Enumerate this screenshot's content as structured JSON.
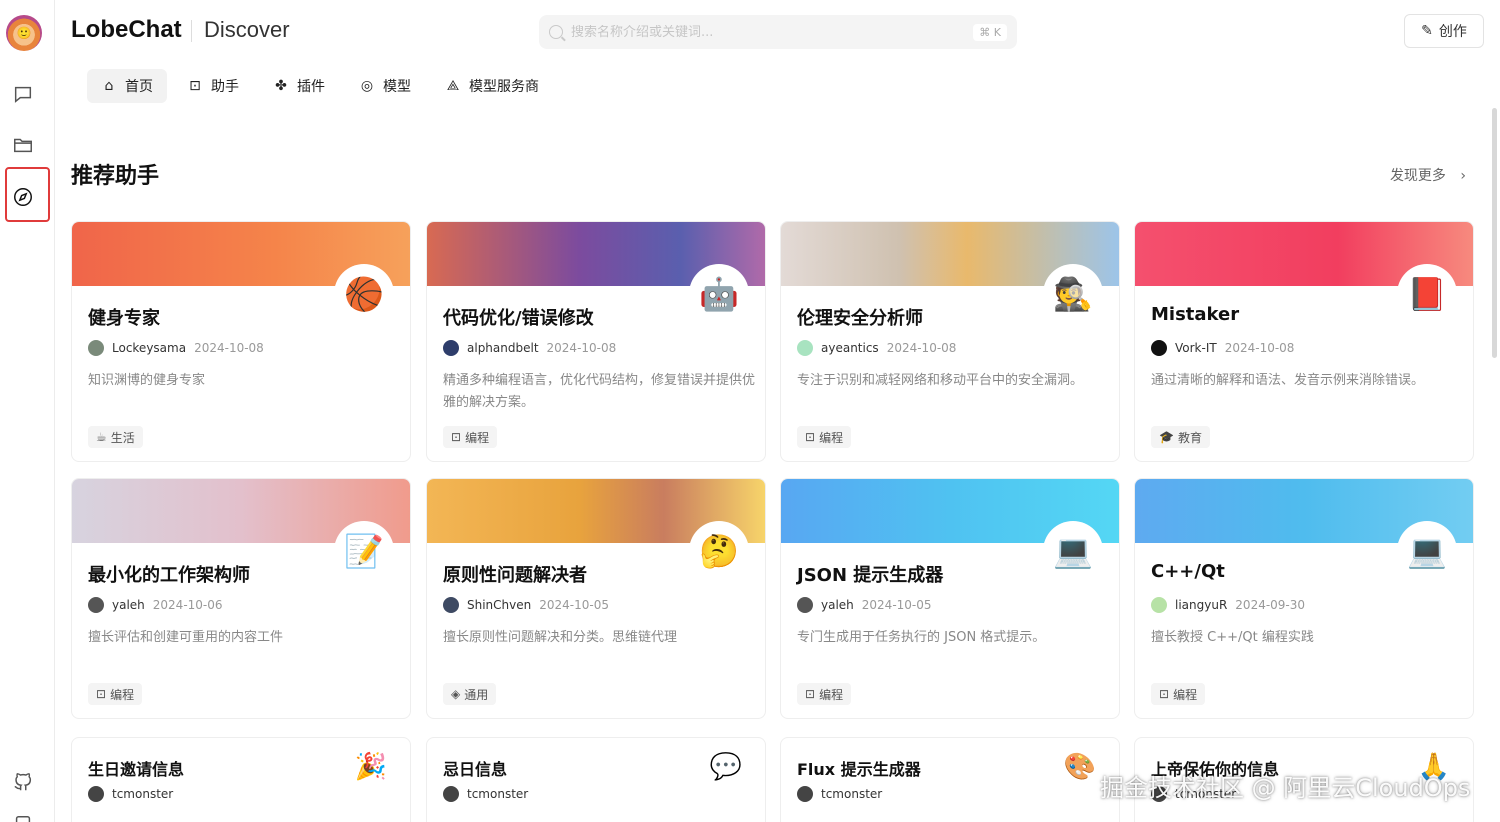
{
  "header": {
    "brand": "LobeChat",
    "subtitle": "Discover",
    "search_placeholder": "搜索名称介绍或关键词...",
    "search_shortcut": "⌘ K",
    "create_label": "创作"
  },
  "tabs": [
    {
      "label": "首页",
      "icon": "home-icon",
      "active": true
    },
    {
      "label": "助手",
      "icon": "bot-icon",
      "active": false
    },
    {
      "label": "插件",
      "icon": "puzzle-icon",
      "active": false
    },
    {
      "label": "模型",
      "icon": "brain-icon",
      "active": false
    },
    {
      "label": "模型服务商",
      "icon": "provider-icon",
      "active": false
    }
  ],
  "section": {
    "title": "推荐助手",
    "more_label": "发现更多"
  },
  "cards": [
    {
      "title": "健身专家",
      "emoji": "🏀",
      "author": "Lockeysama",
      "date": "2024-10-08",
      "desc": "知识渊博的健身专家",
      "tag": "生活",
      "banner": "#f47a45"
    },
    {
      "title": "代码优化/错误修改",
      "emoji": "🤖",
      "author": "alphandbelt",
      "date": "2024-10-08",
      "desc": "精通多种编程语言，优化代码结构，修复错误并提供优雅的解决方案。",
      "tag": "编程",
      "banner": "#6d4fa6"
    },
    {
      "title": "伦理安全分析师",
      "emoji": "🕵️",
      "author": "ayeantics",
      "date": "2024-10-08",
      "desc": "专注于识别和减轻网络和移动平台中的安全漏洞。",
      "tag": "编程",
      "banner": "#c9c2b8"
    },
    {
      "title": "Mistaker",
      "emoji": "📕",
      "author": "Vork-IT",
      "date": "2024-10-08",
      "desc": "通过清晰的解释和语法、发音示例来消除错误。",
      "tag": "教育",
      "banner": "#f2466a"
    },
    {
      "title": "最小化的工作架构师",
      "emoji": "📝",
      "author": "yaleh",
      "date": "2024-10-06",
      "desc": "擅长评估和创建可重用的内容工件",
      "tag": "编程",
      "banner": "#e2b2b8"
    },
    {
      "title": "原则性问题解决者",
      "emoji": "🤔",
      "author": "ShinChven",
      "date": "2024-10-05",
      "desc": "擅长原则性问题解决和分类。思维链代理",
      "tag": "通用",
      "banner": "#f0a440"
    },
    {
      "title": "JSON 提示生成器",
      "emoji": "💻",
      "author": "yaleh",
      "date": "2024-10-05",
      "desc": "专门生成用于任务执行的 JSON 格式提示。",
      "tag": "编程",
      "banner": "#4fb5f0"
    },
    {
      "title": "C++/Qt",
      "emoji": "💻",
      "author": "liangyuR",
      "date": "2024-09-30",
      "desc": "擅长教授 C++/Qt 编程实践",
      "tag": "编程",
      "banner": "#5ab6ee"
    },
    {
      "title": "生日邀请信息",
      "emoji": "🎉",
      "author": "tcmonster",
      "date": "",
      "desc": "",
      "tag": "",
      "banner": ""
    },
    {
      "title": "忌日信息",
      "emoji": "💬",
      "author": "tcmonster",
      "date": "",
      "desc": "",
      "tag": "",
      "banner": ""
    },
    {
      "title": "Flux 提示生成器",
      "emoji": "🎨",
      "author": "tcmonster",
      "date": "",
      "desc": "",
      "tag": "",
      "banner": ""
    },
    {
      "title": "上帝保佑你的信息",
      "emoji": "🙏",
      "author": "tcmonster",
      "date": "",
      "desc": "",
      "tag": "",
      "banner": ""
    }
  ],
  "watermark": "掘金技术社区 @ 阿里云CloudOps"
}
